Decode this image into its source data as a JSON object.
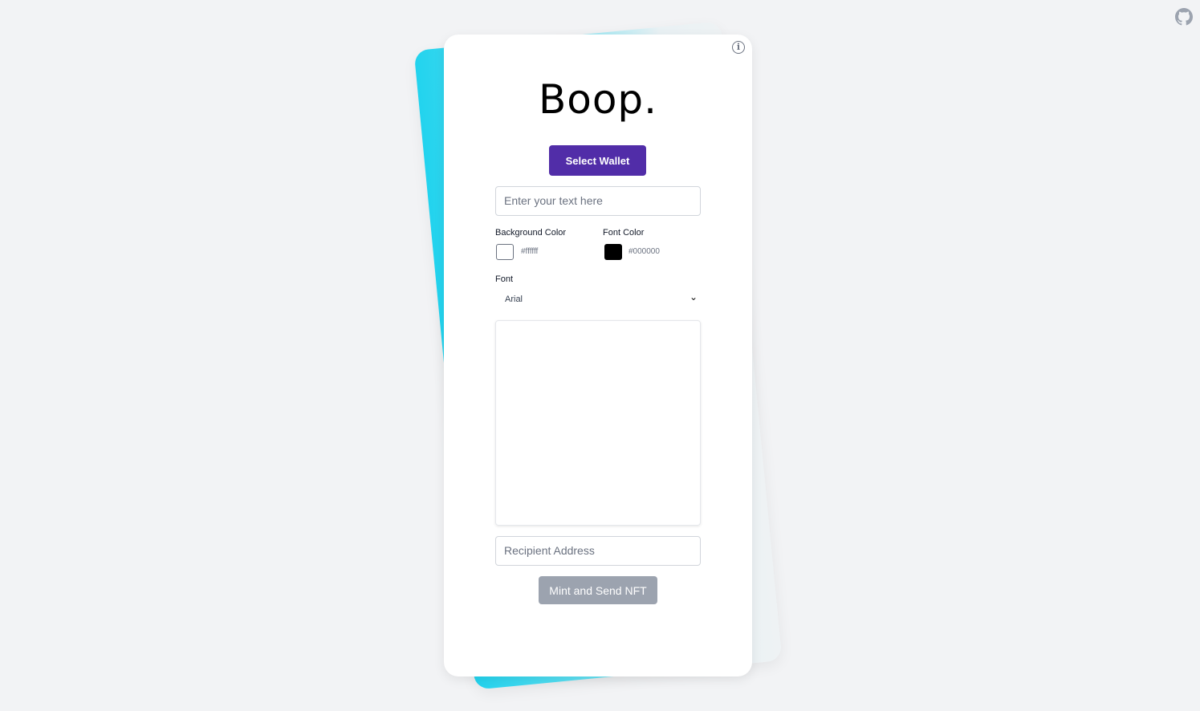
{
  "header": {
    "github_icon": "github-icon"
  },
  "card": {
    "logo": "Boop.",
    "info_icon": "info-icon",
    "select_wallet": "Select Wallet",
    "text_placeholder": "Enter your text here",
    "background_color": {
      "label": "Background Color",
      "value": "#ffffff"
    },
    "font_color": {
      "label": "Font Color",
      "value": "#000000"
    },
    "font": {
      "label": "Font",
      "selected": "Arial"
    },
    "recipient_placeholder": "Recipient Address",
    "mint_button": "Mint and Send NFT"
  },
  "colors": {
    "accent": "#512da8",
    "disabled": "#9ca3af",
    "background_card": "#22d3ee"
  }
}
